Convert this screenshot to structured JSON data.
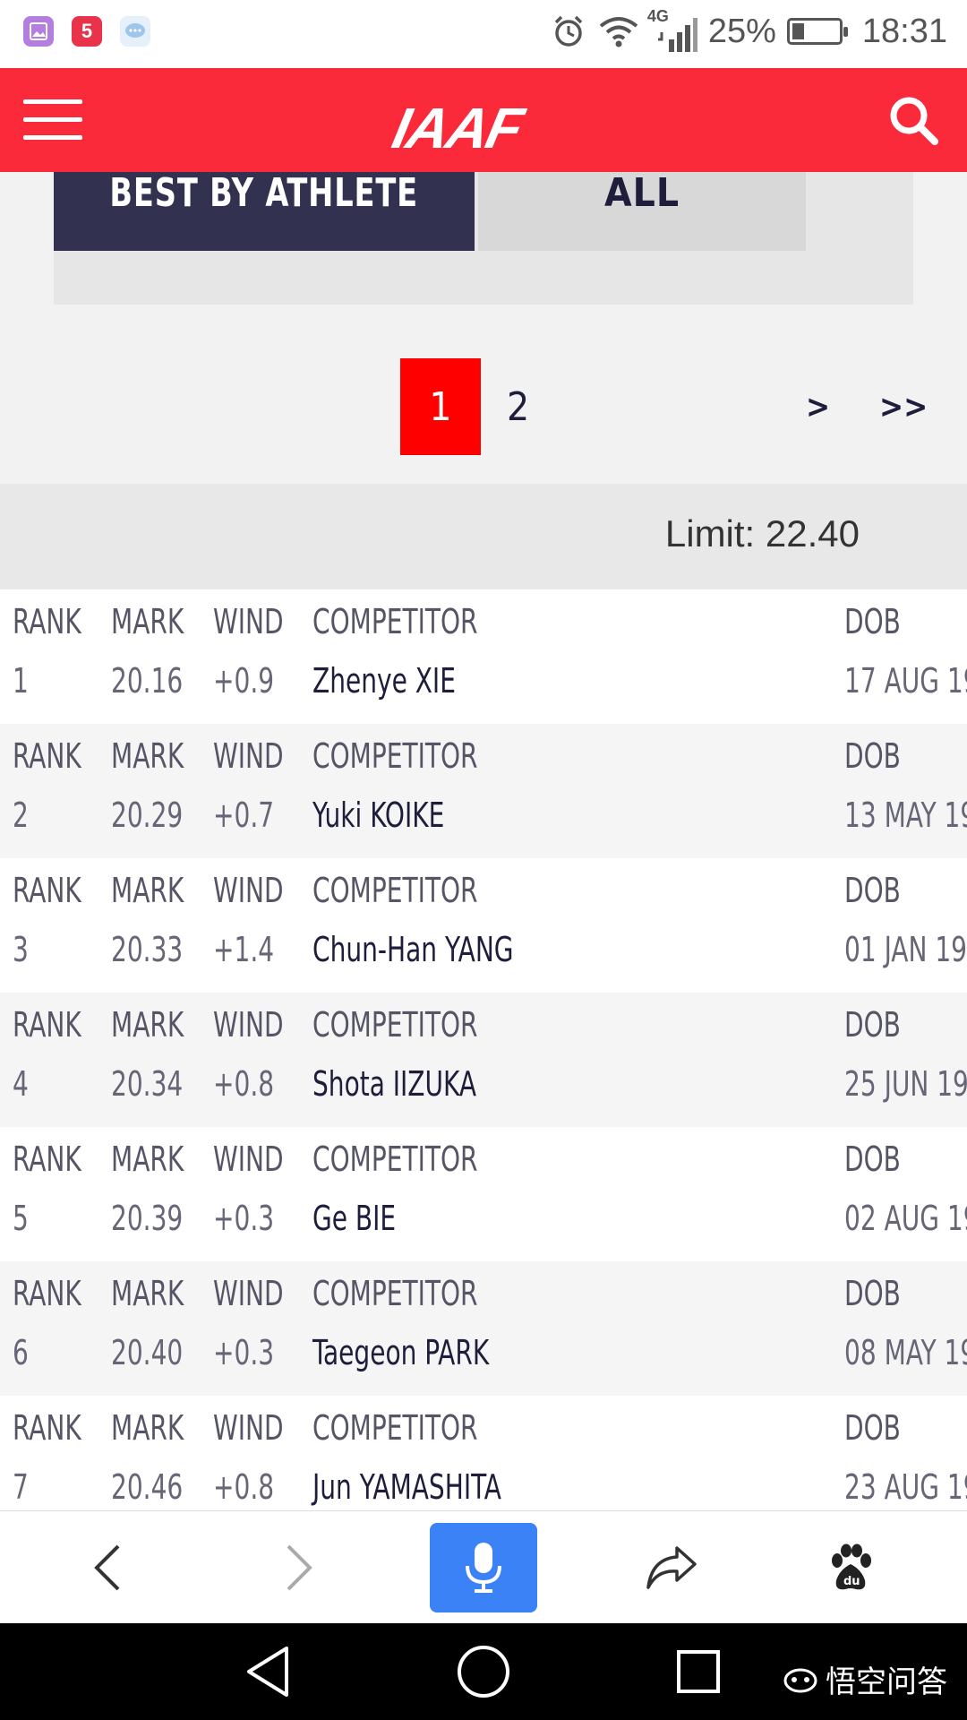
{
  "status_bar": {
    "network": "4G",
    "battery": "25%",
    "battery_level": 0.25,
    "time": "18:31",
    "app_icons": [
      "gallery-icon",
      "five-app-icon",
      "message-icon"
    ],
    "app_five_label": "5"
  },
  "header": {
    "logo": "IAAF"
  },
  "filter": {
    "best_by_athlete": "BEST BY ATHLETE",
    "all": "ALL"
  },
  "pagination": {
    "current": "1",
    "page2": "2",
    "next": ">",
    "last": ">>"
  },
  "limit": "Limit: 22.40",
  "columns": {
    "rank": "RANK",
    "mark": "MARK",
    "wind": "WIND",
    "competitor": "COMPETITOR",
    "dob": "DOB"
  },
  "rows": [
    {
      "rank": "1",
      "mark": "20.16",
      "wind": "+0.9",
      "competitor": "Zhenye XIE",
      "dob": "17 AUG 19"
    },
    {
      "rank": "2",
      "mark": "20.29",
      "wind": "+0.7",
      "competitor": "Yuki KOIKE",
      "dob": "13 MAY 19"
    },
    {
      "rank": "3",
      "mark": "20.33",
      "wind": "+1.4",
      "competitor": "Chun-Han YANG",
      "dob": "01 JAN 19"
    },
    {
      "rank": "4",
      "mark": "20.34",
      "wind": "+0.8",
      "competitor": "Shota IIZUKA",
      "dob": "25 JUN 19"
    },
    {
      "rank": "5",
      "mark": "20.39",
      "wind": "+0.3",
      "competitor": "Ge BIE",
      "dob": "02 AUG 19"
    },
    {
      "rank": "6",
      "mark": "20.40",
      "wind": "+0.3",
      "competitor": "Taegeon PARK",
      "dob": "08 MAY 19"
    },
    {
      "rank": "7",
      "mark": "20.46",
      "wind": "+0.8",
      "competitor": "Jun YAMASHITA",
      "dob": "23 AUG 19"
    }
  ],
  "browser_bar": {
    "icons": [
      "back-icon",
      "forward-icon",
      "microphone-icon",
      "share-icon",
      "baidu-paw-icon"
    ],
    "baidu_label": "du"
  },
  "watermark": "悟空问答",
  "colors": {
    "brand_red": "#fb2a3a",
    "active_page": "#ff0000",
    "filter_active": "#323250",
    "mic_blue": "#3b82f6"
  }
}
